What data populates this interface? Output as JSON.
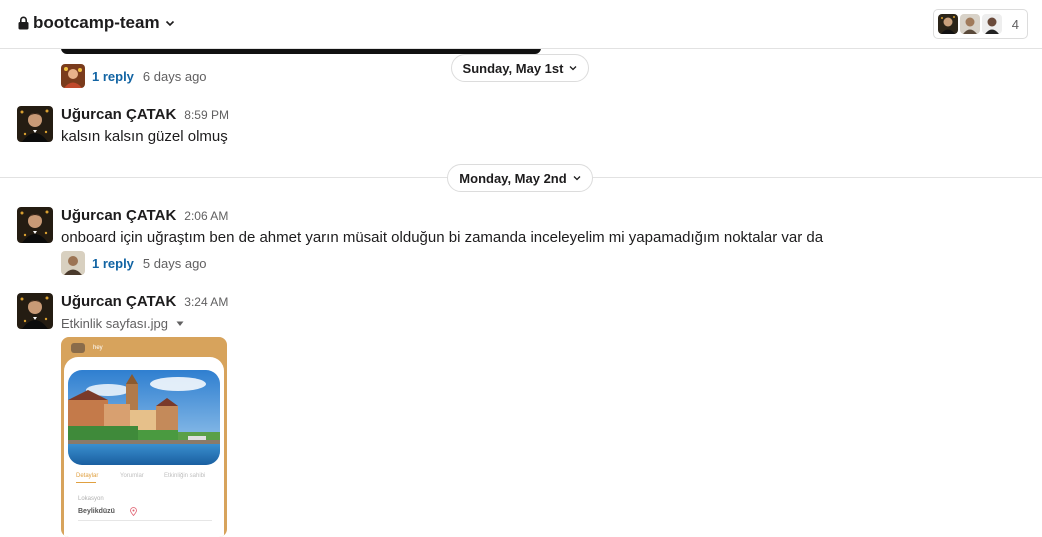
{
  "header": {
    "channel_name": "bootcamp-team",
    "member_count": "4"
  },
  "colors": {
    "link": "#1264a3",
    "muted": "#616061",
    "text": "#1d1c1d",
    "attachment_bg": "#d7a35c"
  },
  "icons": {
    "lock": "lock-icon",
    "channel_chevron": "chevron-down-icon",
    "date_chevron": "chevron-down-icon",
    "file_caret": "caret-down-icon",
    "location": "location-pin-icon"
  },
  "threads": [
    {
      "reply_label": "1 reply",
      "reply_time": "6 days ago"
    },
    {
      "reply_label": "1 reply",
      "reply_time": "5 days ago"
    }
  ],
  "dividers": [
    {
      "label": "Sunday, May 1st"
    },
    {
      "label": "Monday, May 2nd"
    }
  ],
  "messages": [
    {
      "sender": "Uğurcan ÇATAK",
      "time": "8:59 PM",
      "text": "kalsın kalsın güzel olmuş"
    },
    {
      "sender": "Uğurcan ÇATAK",
      "time": "2:06 AM",
      "text": "onboard için uğraştım ben de ahmet yarın müsait olduğun bi zamanda inceleyelim mi yapamadığım noktalar var da"
    },
    {
      "sender": "Uğurcan ÇATAK",
      "time": "3:24 AM",
      "file_name": "Etkinlik sayfası.jpg"
    }
  ],
  "attachment": {
    "status_text": "hey",
    "tabs": [
      "Detaylar",
      "Yorumlar",
      "Etkinliğin sahibi"
    ],
    "location_label": "Lokasyon",
    "location_value": "Beylikdüzü"
  }
}
